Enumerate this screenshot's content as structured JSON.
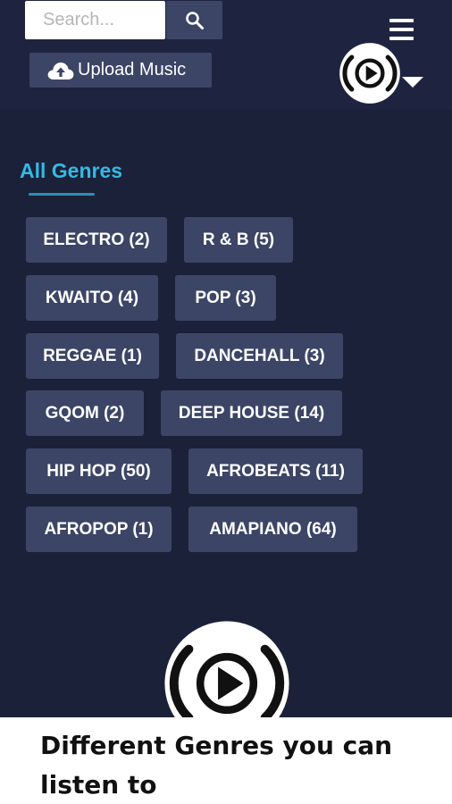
{
  "header": {
    "search": {
      "placeholder": "Search...",
      "value": "",
      "button_icon": "search-icon"
    },
    "upload": {
      "label": "Upload Music",
      "icon": "cloud-upload-icon"
    },
    "menu_icon": "hamburger-menu-icon",
    "logo_icon": "play-logo-icon",
    "dropdown_icon": "caret-down-icon"
  },
  "section": {
    "title": "All Genres"
  },
  "genres": [
    {
      "label": "ELECTRO (2)"
    },
    {
      "label": "R & B (5)"
    },
    {
      "label": "KWAITO (4)"
    },
    {
      "label": "POP (3)"
    },
    {
      "label": "REGGAE (1)"
    },
    {
      "label": "DANCEHALL (3)"
    },
    {
      "label": "GQOM (2)"
    },
    {
      "label": "DEEP HOUSE (14)"
    },
    {
      "label": "HIP HOP (50)"
    },
    {
      "label": "AFROBEATS (11)"
    },
    {
      "label": "AFROPOP (1)"
    },
    {
      "label": "AMAPIANO (64)"
    }
  ],
  "caption": {
    "text": "Different Genres you can listen to"
  },
  "colors": {
    "background": "#1b2138",
    "header": "#1e2440",
    "chip": "#3c4566",
    "accent": "#35b9e6"
  }
}
